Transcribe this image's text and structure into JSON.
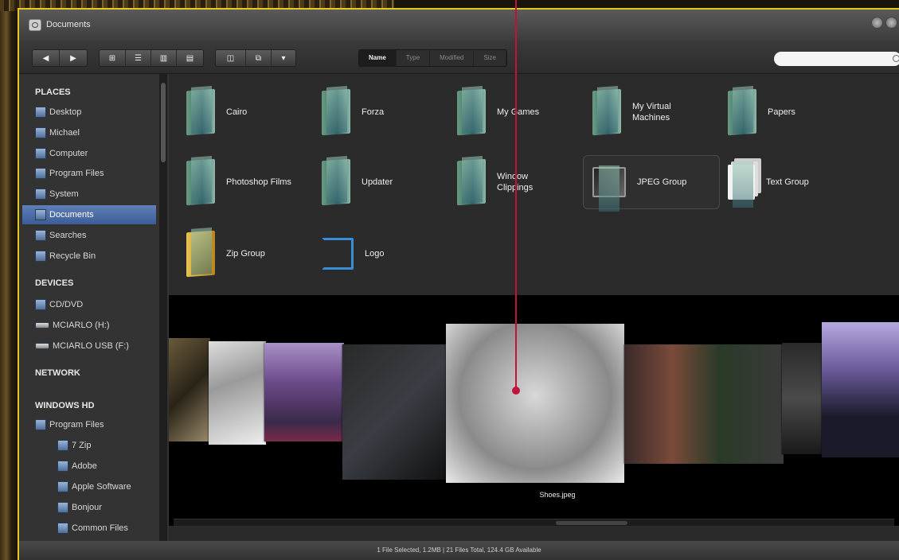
{
  "window": {
    "title": "Documents"
  },
  "toolbar": {
    "back_label": "◀",
    "forward_label": "▶",
    "view_buttons": [
      "⊞",
      "☰",
      "▥",
      "▤"
    ],
    "coverflow_button": "◫",
    "sort_tabs": [
      "Name",
      "Type",
      "Modified",
      "Size"
    ],
    "active_sort": "Name",
    "search_placeholder": ""
  },
  "sidebar": {
    "places_heading": "PLACES",
    "places": [
      "Desktop",
      "Michael",
      "Computer",
      "Program Files",
      "System",
      "Documents",
      "Searches",
      "Recycle Bin"
    ],
    "selected": "Documents",
    "devices_heading": "DEVICES",
    "devices": [
      "CD/DVD",
      "MCIARLO (H:)",
      "MCIARLO USB (F:)"
    ],
    "network_heading": "NETWORK",
    "windows_heading": "WINDOWS HD",
    "windows_items": [
      "Program Files",
      "7 Zip",
      "Adobe",
      "Apple Software",
      "Bonjour",
      "Common Files"
    ]
  },
  "folders": [
    {
      "name": "Cairo",
      "line2": ""
    },
    {
      "name": "Forza",
      "line2": ""
    },
    {
      "name": "My Games",
      "line2": ""
    },
    {
      "name": "My Virtual",
      "line2": "Machines"
    },
    {
      "name": "Papers",
      "line2": ""
    },
    {
      "name": "Photoshop Films",
      "line2": ""
    },
    {
      "name": "Updater",
      "line2": ""
    },
    {
      "name": "Window",
      "line2": "Clippings"
    },
    {
      "name": "JPEG Group",
      "line2": ""
    },
    {
      "name": "Text Group",
      "line2": ""
    },
    {
      "name": "Zip Group",
      "line2": ""
    },
    {
      "name": "Logo",
      "line2": ""
    }
  ],
  "coverflow": {
    "selected_label": "Shoes.jpeg"
  },
  "statusbar": {
    "text": "1 File Selected, 1.2MB  |  21 Files Total, 124.4 GB Available"
  },
  "colors": {
    "window_border": "#e6c81e",
    "selection": "#4a6ea8",
    "callout": "#c1123a"
  }
}
